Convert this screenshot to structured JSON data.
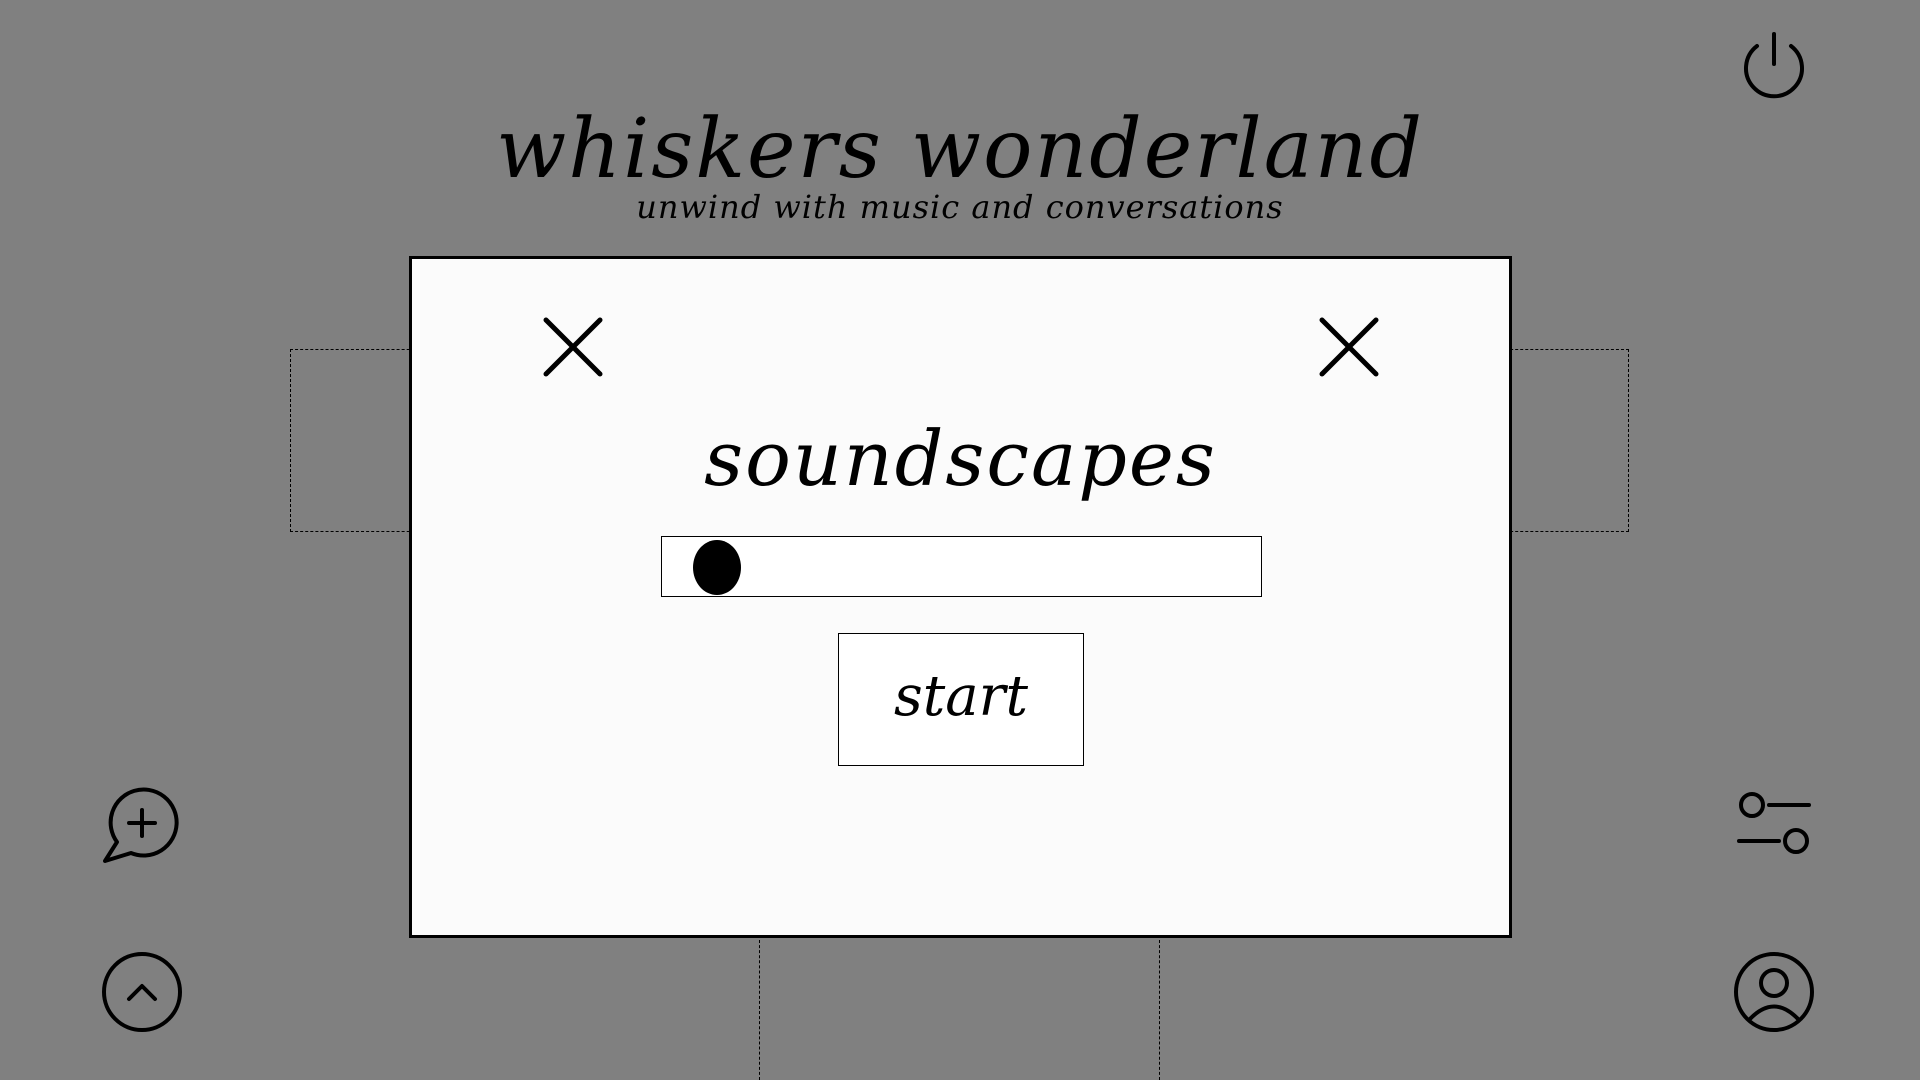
{
  "header": {
    "title": "whiskers wonderland",
    "subtitle": "unwind with music and conversations"
  },
  "corner_buttons": {
    "power": {
      "icon": "power-icon"
    },
    "new_chat": {
      "icon": "chat-plus-icon"
    },
    "scroll_up": {
      "icon": "chevron-up-circle-icon"
    },
    "settings": {
      "icon": "sliders-icon"
    },
    "profile": {
      "icon": "user-circle-icon"
    }
  },
  "modal": {
    "title": "soundscapes",
    "close_icon": "close-icon",
    "slider": {
      "value": 0.05
    },
    "start_label": "start"
  },
  "colors": {
    "background": "#808080",
    "modal": "#fbfbfb",
    "ink": "#000000"
  }
}
